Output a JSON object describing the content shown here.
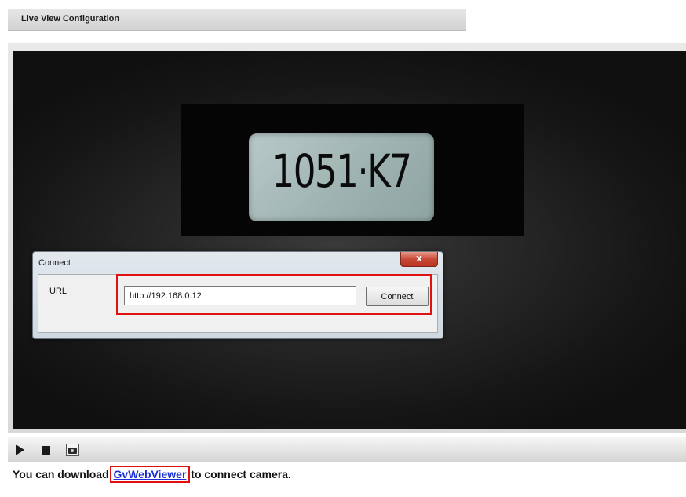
{
  "header": {
    "title": "Live View Configuration"
  },
  "video": {
    "plate_text": "1051·K7"
  },
  "connect_dialog": {
    "title": "Connect",
    "close_label": "x",
    "url_label": "URL",
    "url_value": "http://192.168.0.12",
    "connect_button": "Connect"
  },
  "controls": {
    "play_icon": "play-icon",
    "stop_icon": "stop-icon",
    "snapshot_icon": "camera-snapshot-icon"
  },
  "footer": {
    "text_before": "You can download ",
    "link_text": "GvWebViewer",
    "text_after": " to connect camera."
  },
  "colors": {
    "highlight": "#e01010",
    "link": "#1a2fd6",
    "close_button": "#c84a36"
  }
}
